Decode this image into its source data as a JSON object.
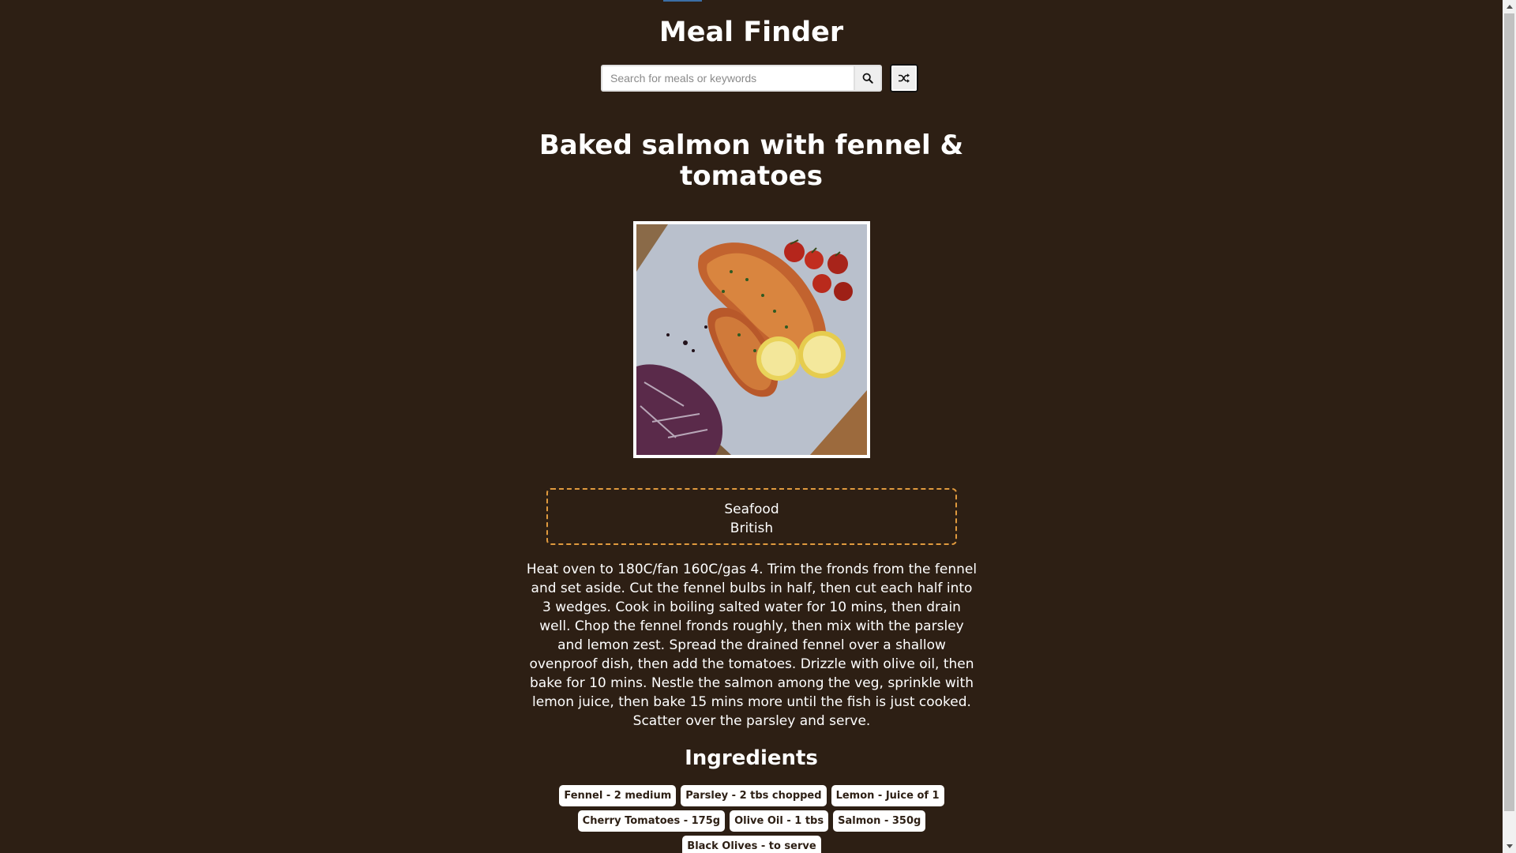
{
  "app": {
    "title": "Meal Finder"
  },
  "search": {
    "placeholder": "Search for meals or keywords",
    "value": "",
    "search_icon": "search-icon",
    "random_icon": "shuffle-icon"
  },
  "meal": {
    "title_line1": "Baked salmon with fennel &",
    "title_line2": "tomatoes",
    "image_alt": "Baked salmon with fennel & tomatoes",
    "category": "Seafood",
    "area": "British",
    "instructions": "Heat oven to 180C/fan 160C/gas 4. Trim the fronds from the fennel and set aside. Cut the fennel bulbs in half, then cut each half into 3 wedges. Cook in boiling salted water for 10 mins, then drain well. Chop the fennel fronds roughly, then mix with the parsley and lemon zest. Spread the drained fennel over a shallow ovenproof dish, then add the tomatoes. Drizzle with olive oil, then bake for 10 mins. Nestle the salmon among the veg, sprinkle with lemon juice, then bake 15 mins more until the fish is just cooked. Scatter over the parsley and serve.",
    "ingredients_heading": "Ingredients",
    "ingredients": [
      "Fennel - 2 medium",
      "Parsley - 2 tbs chopped",
      "Lemon - Juice of 1",
      "Cherry Tomatoes - 175g",
      "Olive Oil - 1 tbs",
      "Salmon - 350g",
      "Black Olives - to serve"
    ]
  },
  "colors": {
    "background": "#2d1f14",
    "text": "#ffffff",
    "info_border": "#e09a3e"
  }
}
